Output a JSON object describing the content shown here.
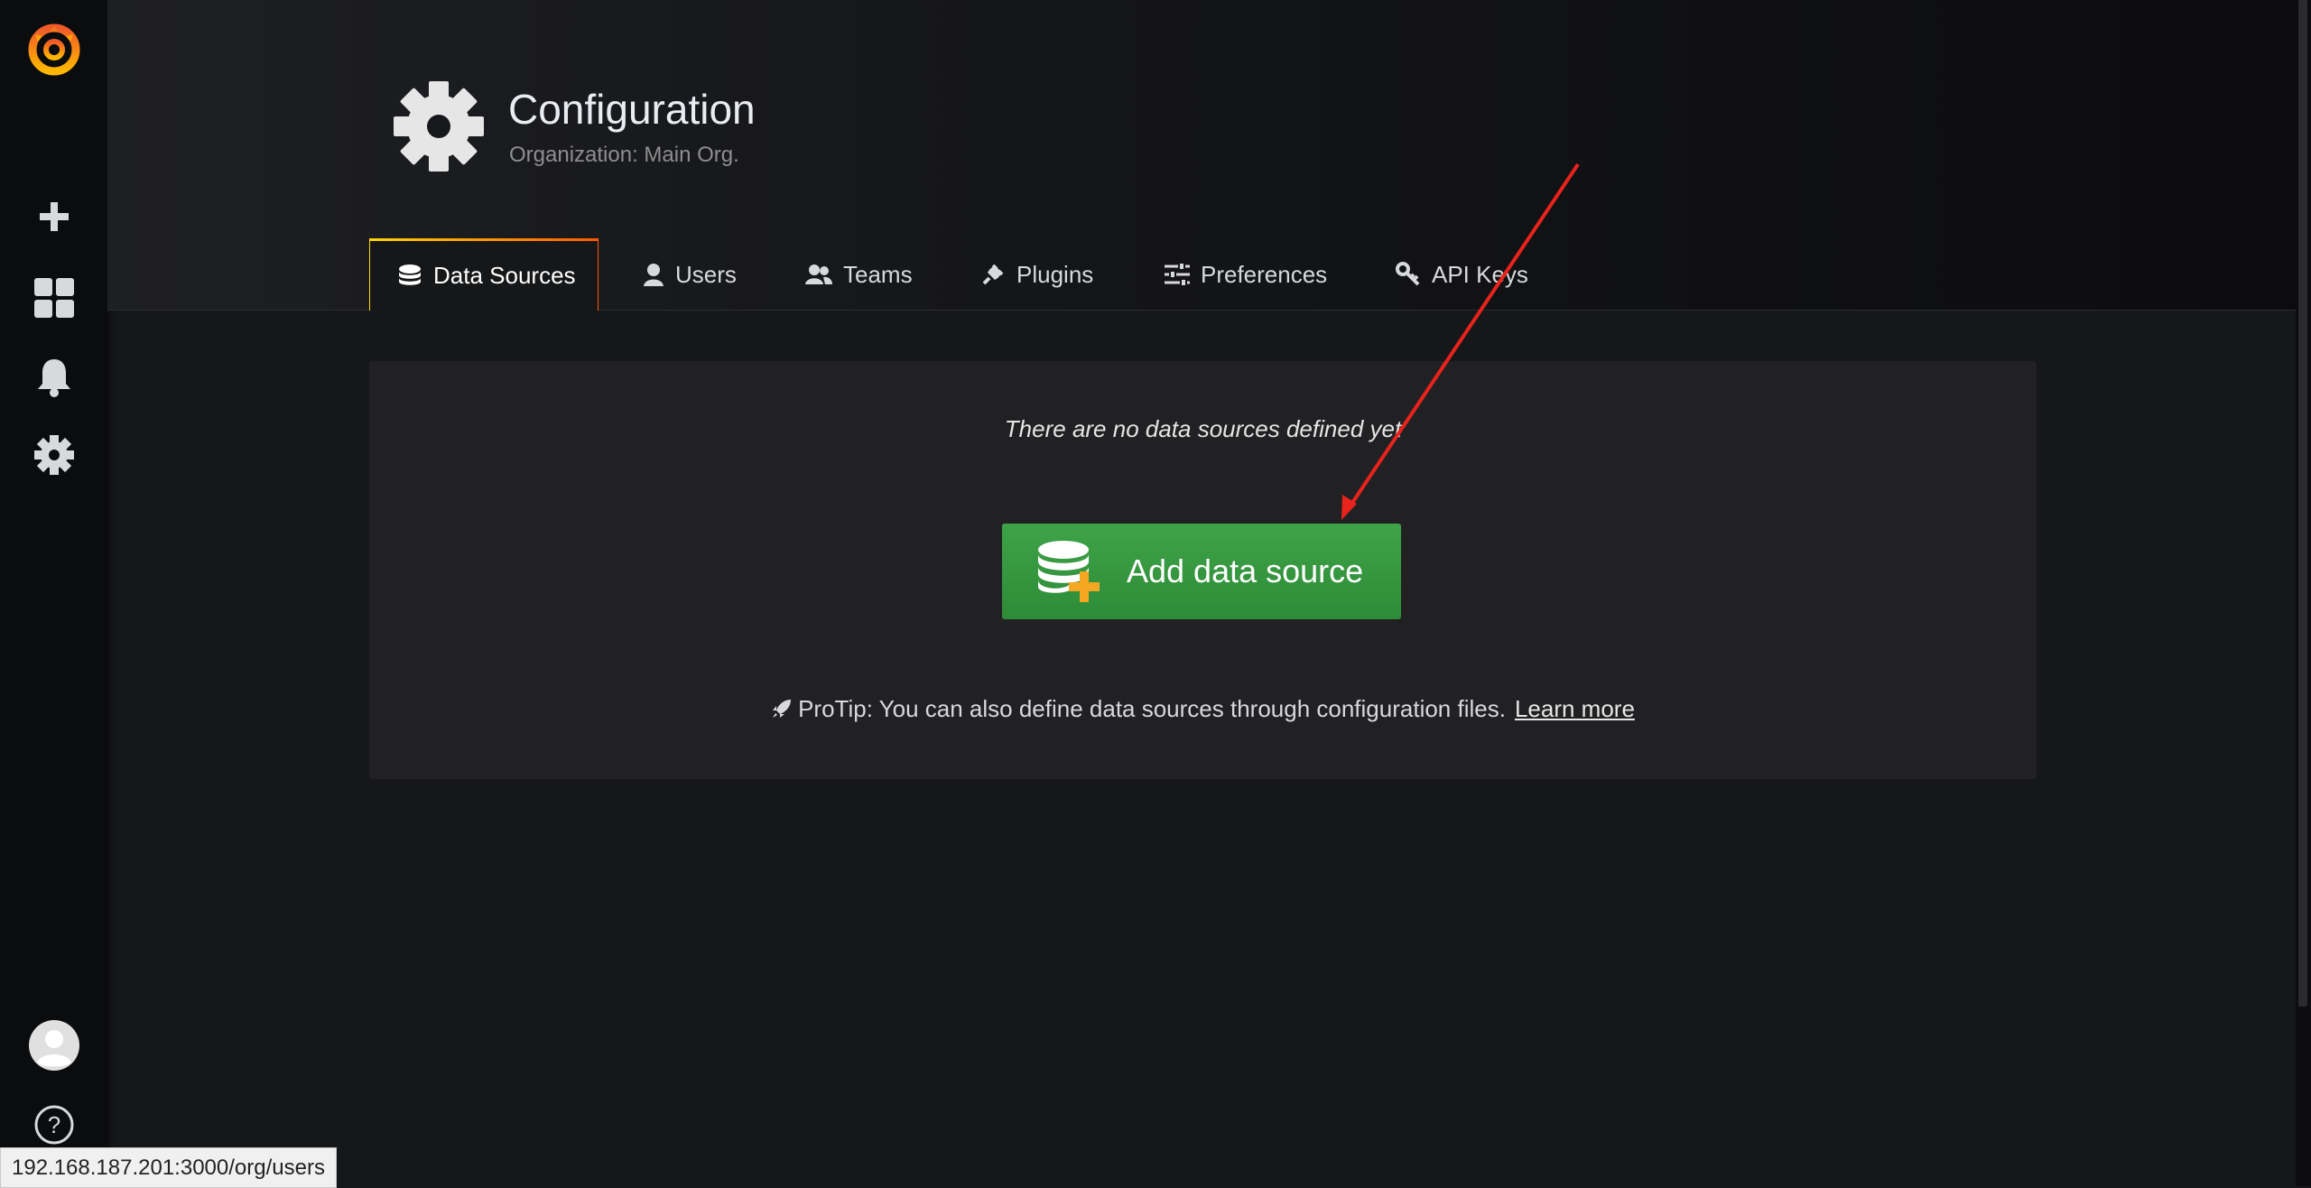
{
  "page": {
    "title": "Configuration",
    "subtitle": "Organization: Main Org."
  },
  "tabs": [
    {
      "label": "Data Sources",
      "icon": "database-icon",
      "active": true
    },
    {
      "label": "Users",
      "icon": "user-icon",
      "active": false
    },
    {
      "label": "Teams",
      "icon": "users-icon",
      "active": false
    },
    {
      "label": "Plugins",
      "icon": "plug-icon",
      "active": false
    },
    {
      "label": "Preferences",
      "icon": "sliders-icon",
      "active": false
    },
    {
      "label": "API Keys",
      "icon": "key-icon",
      "active": false
    }
  ],
  "empty_state": {
    "message": "There are no data sources defined yet",
    "button_label": "Add data source",
    "protip": "ProTip: You can also define data sources through configuration files.",
    "learn_more": "Learn more"
  },
  "sidebar": {
    "items": [
      "grafana-logo-icon",
      "plus-icon",
      "dashboards-icon",
      "alerting-bell-icon",
      "configuration-gear-icon",
      "user-avatar-icon",
      "help-icon"
    ]
  },
  "statusbar": {
    "url": "192.168.187.201:3000/org/users"
  },
  "colors": {
    "accent_green": "#3ea348",
    "tab_gradient_start": "#ffd500",
    "tab_gradient_end": "#ff5a00",
    "annotation_arrow": "#e8231c"
  }
}
